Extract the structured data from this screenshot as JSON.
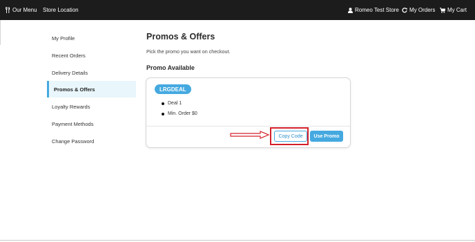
{
  "nav": {
    "left": [
      {
        "label": "Our Menu",
        "icon": "utensils-icon"
      },
      {
        "label": "Store Location"
      }
    ],
    "right": [
      {
        "label": "Romeo Test Store",
        "icon": "user-icon"
      },
      {
        "label": "My Orders",
        "icon": "refresh-icon"
      },
      {
        "label": "My Cart",
        "icon": "cart-icon"
      }
    ]
  },
  "sidebar": {
    "items": [
      {
        "label": "My Profile"
      },
      {
        "label": "Recent Orders"
      },
      {
        "label": "Delivery Details"
      },
      {
        "label": "Promos & Offers",
        "active": true
      },
      {
        "label": "Loyalty Rewards"
      },
      {
        "label": "Payment Methods"
      },
      {
        "label": "Change Password"
      }
    ]
  },
  "main": {
    "title": "Promos & Offers",
    "subtitle": "Pick the promo you want on checkout.",
    "section_title": "Promo Available",
    "promo": {
      "code": "LRGDEAL",
      "details": [
        "Deal 1",
        "Min. Order $0"
      ],
      "copy_label": "Copy Code",
      "use_label": "Use Promo"
    }
  },
  "colors": {
    "nav_bg": "#1c1c1c",
    "accent": "#45a9e0",
    "active_bg": "#e9f6fb",
    "annotation_red": "#d4202a"
  }
}
